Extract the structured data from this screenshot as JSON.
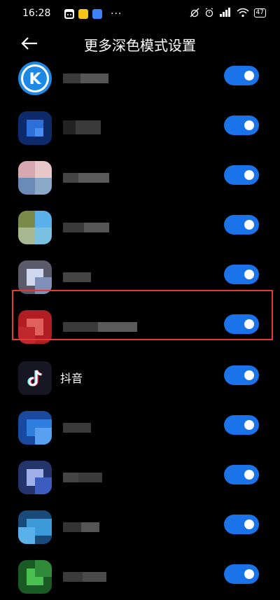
{
  "status_bar": {
    "time": "16:28",
    "battery": "47",
    "extra_dots": "···",
    "icons": [
      "wechat-icon",
      "app-notify-icon",
      "browser-icon",
      "alarm-off-icon",
      "alarm-icon",
      "signal-icon",
      "wifi-icon",
      "battery-icon"
    ]
  },
  "header": {
    "title": "更多深色模式设置"
  },
  "list": {
    "rows": [
      {
        "label": "",
        "enabled": true,
        "icon_color": "#1e88e5"
      },
      {
        "label": "",
        "enabled": true,
        "icon_color": "#1e64c8"
      },
      {
        "label": "",
        "enabled": true,
        "icon_color": "#c89aa0"
      },
      {
        "label": "",
        "enabled": true,
        "icon_color": "#6fa8c8"
      },
      {
        "label": "",
        "enabled": true,
        "icon_color": "#a8b4d8"
      },
      {
        "label": "",
        "enabled": true,
        "icon_color": "#c0262c"
      },
      {
        "label": "抖音",
        "enabled": true,
        "icon_color": "#1a1a24"
      },
      {
        "label": "",
        "enabled": true,
        "icon_color": "#2f7fe0"
      },
      {
        "label": "",
        "enabled": true,
        "icon_color": "#3d5cc0"
      },
      {
        "label": "",
        "enabled": true,
        "icon_color": "#3d9ad8"
      },
      {
        "label": "",
        "enabled": true,
        "icon_color": "#3fae4a"
      }
    ]
  },
  "colors": {
    "toggle_on": "#1a73e8",
    "highlight_border": "#e53935"
  }
}
